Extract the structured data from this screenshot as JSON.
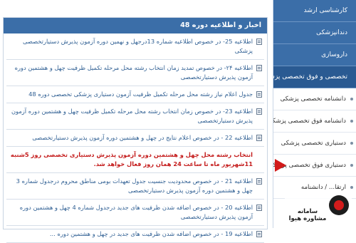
{
  "sidebar": {
    "items": [
      {
        "label": "کارشناسی ارشد"
      },
      {
        "label": "دندانپزشکی"
      },
      {
        "label": "داروسازی"
      },
      {
        "label": "تخصصی و فوق تخصصی پزشکی"
      }
    ],
    "sub_items": [
      {
        "label": "دانشنامه تخصصی پزشکی"
      },
      {
        "label": "دانشنامه فوق تخصصی پزشکی"
      },
      {
        "label": "دستیاری تخصصی پزشکی"
      },
      {
        "label": "دستیاری فوق تخصصی پزشکی"
      },
      {
        "label": "ارتقا... / دانشنامه"
      }
    ]
  },
  "panel": {
    "title": "اخبار و اطلاعیه دوره 48"
  },
  "rows": [
    {
      "text": "اطلاعیه 25- در خصوص اطلاعیه شماره 13درجهل و نهمین دوره آزمون پذیرش دستیارتخصصی پزشکی"
    },
    {
      "text": "اطلاعیه ۲۴- در خصوص تمدید زمان انتخاب رشته محل مرحله تکمیل ظرفیت چهل و هشتمین دوره آزمون پذیرش دستیارتخصصی"
    },
    {
      "text": "جدول اعلام نیاز رشته محل مرحله تکمیل ظرفیت آزمون دستیاری پزشکی تخصصی دوره 48"
    },
    {
      "text": "اطلاعیه 23- در خصوص زمان انتخاب رشته محل مرحله تکمیل ظرفیت چهل و هشتمین دوره آزمون پذیرش دستیارتخصصی"
    },
    {
      "text": "اطلاعیه 22 - در خصوص اعلام نتایج در چهل و هشتمین دوره آزمون پذیرش دستیارتخصصی"
    },
    {
      "text": "انتخاب رشته محل چهل و هشتمین دوره آزمون پذیرش دستیاری تخصصی روز 5شنبه 11شهریور ماه تا ساعت 24 همان روز فعال خواهد شد."
    },
    {
      "text": "اطلاعیه 21 - در خصوص محدودیت جنسیت جدول تعهدات بومی مناطق محروم درجدول شماره 3 چهل و هشتمین دوره آزمون پذیرش دستیارتخصصی"
    },
    {
      "text": "اطلاعیه 20 - در خصوص اضافه شدن ظرفیت های جدید درجدول شماره 4 چهل و هشتمین دوره آزمون پذیرش دستیارتخصصی"
    },
    {
      "text": "اطلاعیه 19 - در خصوص اضافه شدن ظرفیت های جدید در چهل و هشتمین دوره ..."
    }
  ],
  "watermark": {
    "text": "سامانه مشاوره هیوا"
  },
  "colors": {
    "accent": "#3b6ea8",
    "highlight_red": "#c41b1b"
  },
  "icons": [
    "document-icon",
    "red-arrow-icon",
    "logo-icon"
  ]
}
